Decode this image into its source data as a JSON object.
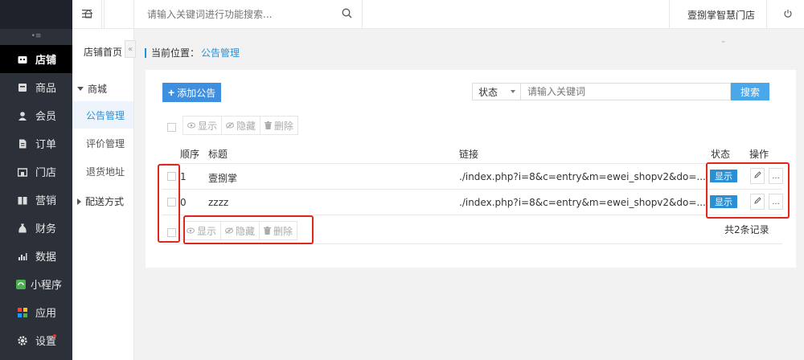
{
  "header": {
    "search_placeholder": "请输入关键词进行功能搜索...",
    "store_name": "壹捌掌智慧门店"
  },
  "sidebar": {
    "items": [
      {
        "label": "店铺",
        "icon": "store-icon",
        "active": true
      },
      {
        "label": "商品",
        "icon": "goods-icon"
      },
      {
        "label": "会员",
        "icon": "member-icon"
      },
      {
        "label": "订单",
        "icon": "order-icon"
      },
      {
        "label": "门店",
        "icon": "shop-icon"
      },
      {
        "label": "营销",
        "icon": "marketing-icon"
      },
      {
        "label": "财务",
        "icon": "finance-icon"
      },
      {
        "label": "数据",
        "icon": "data-icon"
      },
      {
        "label": "小程序",
        "icon": "miniprogram-icon"
      },
      {
        "label": "应用",
        "icon": "apps-icon"
      },
      {
        "label": "设置",
        "icon": "settings-icon"
      }
    ]
  },
  "subnav": {
    "home": "店铺首页",
    "group_mall": "商城",
    "items": [
      {
        "label": "公告管理",
        "active": true
      },
      {
        "label": "评价管理"
      },
      {
        "label": "退货地址"
      }
    ],
    "group_shipping": "配送方式"
  },
  "breadcrumb": {
    "prefix": "当前位置：",
    "current": "公告管理"
  },
  "toolbar": {
    "add_label": "添加公告",
    "filter_select": "状态",
    "filter_placeholder": "请输入关键词",
    "search_label": "搜索"
  },
  "bulk": {
    "show": "显示",
    "hide": "隐藏",
    "delete": "删除"
  },
  "table": {
    "headers": {
      "order": "顺序",
      "title": "标题",
      "link": "链接",
      "status": "状态",
      "ops": "操作"
    },
    "rows": [
      {
        "order": "1",
        "title": "壹捌掌",
        "link": "./index.php?i=8&c=entry&m=ewei_shopv2&do=...",
        "status": "显示"
      },
      {
        "order": "0",
        "title": "zzzz",
        "link": "./index.php?i=8&c=entry&m=ewei_shopv2&do=...",
        "status": "显示"
      }
    ],
    "total": "共2条记录",
    "more": "..."
  }
}
